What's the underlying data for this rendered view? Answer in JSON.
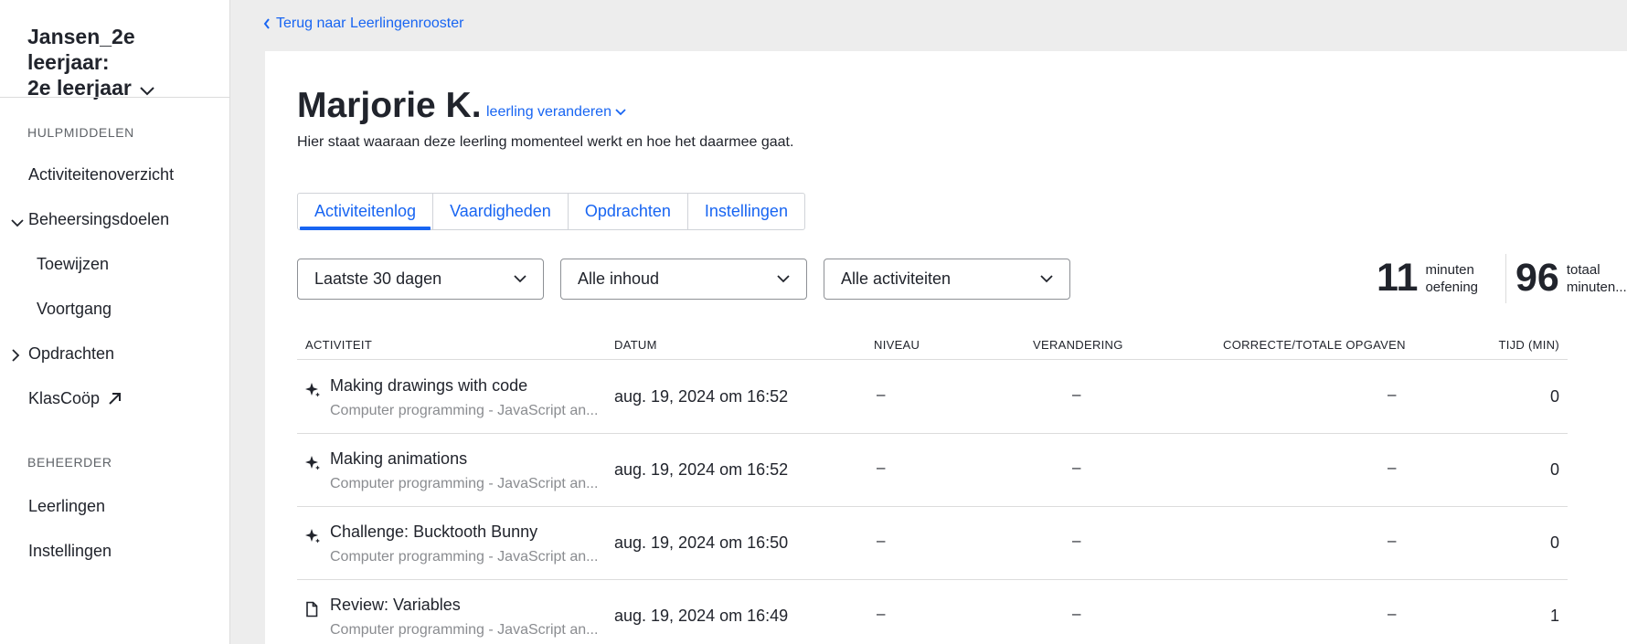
{
  "sidebar": {
    "class_title_line1": "Jansen_2e leerjaar:",
    "class_title_line2": "2e leerjaar",
    "section_tools": "HULPMIDDELEN",
    "section_admin": "BEHEERDER",
    "items": [
      {
        "label": "Activiteitenoverzicht"
      },
      {
        "label": "Beheersingsdoelen"
      },
      {
        "label": "Toewijzen"
      },
      {
        "label": "Voortgang"
      },
      {
        "label": "Opdrachten"
      },
      {
        "label": "KlasCoöp"
      },
      {
        "label": "Leerlingen"
      },
      {
        "label": "Instellingen"
      }
    ]
  },
  "header": {
    "back_link": "Terug naar Leerlingenrooster"
  },
  "student": {
    "name": "Marjorie K.",
    "change_label": "leerling veranderen",
    "subtitle": "Hier staat waaraan deze leerling momenteel werkt en hoe het daarmee gaat."
  },
  "tabs": [
    {
      "label": "Activiteitenlog",
      "active": true
    },
    {
      "label": "Vaardigheden",
      "active": false
    },
    {
      "label": "Opdrachten",
      "active": false
    },
    {
      "label": "Instellingen",
      "active": false
    }
  ],
  "filters": {
    "period": "Laatste 30 dagen",
    "content": "Alle inhoud",
    "activities": "Alle activiteiten"
  },
  "stats": {
    "practice_value": "11",
    "practice_label_line1": "minuten",
    "practice_label_line2": "oefening",
    "total_value": "96",
    "total_label_line1": "totaal",
    "total_label_line2": "minuten..."
  },
  "table": {
    "headers": {
      "activity": "ACTIVITEIT",
      "date": "DATUM",
      "level": "NIVEAU",
      "change": "VERANDERING",
      "correct": "CORRECTE/TOTALE OPGAVEN",
      "time": "TIJD (MIN)"
    },
    "rows": [
      {
        "icon": "sparkle-icon",
        "title": "Making drawings with code",
        "course": "Computer programming - JavaScript an...",
        "date": "aug. 19, 2024 om 16:52",
        "level": "–",
        "change": "–",
        "correct": "–",
        "time": "0"
      },
      {
        "icon": "sparkle-icon",
        "title": "Making animations",
        "course": "Computer programming - JavaScript an...",
        "date": "aug. 19, 2024 om 16:52",
        "level": "–",
        "change": "–",
        "correct": "–",
        "time": "0"
      },
      {
        "icon": "sparkle-icon",
        "title": "Challenge: Bucktooth Bunny",
        "course": "Computer programming - JavaScript an...",
        "date": "aug. 19, 2024 om 16:50",
        "level": "–",
        "change": "–",
        "correct": "–",
        "time": "0"
      },
      {
        "icon": "document-icon",
        "title": "Review: Variables",
        "course": "Computer programming - JavaScript an...",
        "date": "aug. 19, 2024 om 16:49",
        "level": "–",
        "change": "–",
        "correct": "–",
        "time": "1"
      }
    ]
  },
  "colors": {
    "accent": "#1865f2",
    "text": "#21242c",
    "muted": "#8a8c90",
    "background": "#ededed"
  }
}
